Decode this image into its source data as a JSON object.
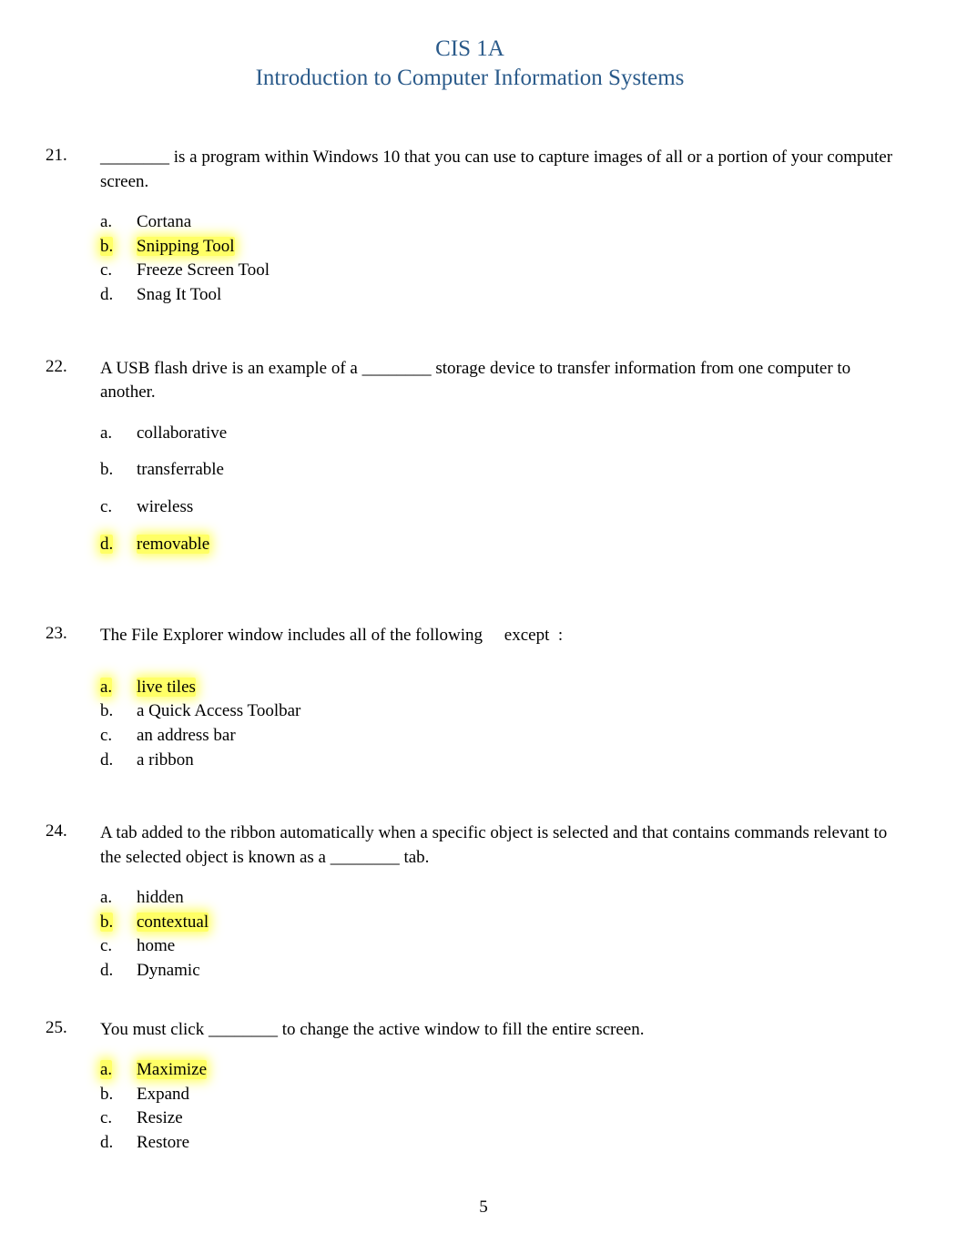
{
  "header": {
    "title": "CIS 1A",
    "subtitle": "Introduction to Computer Information Systems"
  },
  "questions": [
    {
      "num": "21.",
      "text": "________ is a program within Windows 10 that you can use to capture images of all or a portion of your computer screen.",
      "options": [
        {
          "label": "a.",
          "text": "Cortana",
          "highlighted": false
        },
        {
          "label": "b.",
          "text": "Snipping Tool",
          "highlighted": true
        },
        {
          "label": "c.",
          "text": "Freeze Screen Tool",
          "highlighted": false
        },
        {
          "label": "d.",
          "text": "Snag It Tool",
          "highlighted": false
        }
      ]
    },
    {
      "num": "22.",
      "text": "A USB flash drive is an example of a ________ storage device to transfer information from one computer to another.",
      "options": [
        {
          "label": "a.",
          "text": "collaborative",
          "highlighted": false
        },
        {
          "label": "b.",
          "text": "transferrable",
          "highlighted": false
        },
        {
          "label": "c.",
          "text": "wireless",
          "highlighted": false
        },
        {
          "label": "d.",
          "text": "removable",
          "highlighted": true
        }
      ]
    },
    {
      "num": "23.",
      "text": "The File Explorer window includes all of the following     except  :",
      "options": [
        {
          "label": "a.",
          "text": "live tiles",
          "highlighted": true
        },
        {
          "label": "b.",
          "text": "a Quick Access Toolbar",
          "highlighted": false
        },
        {
          "label": "c.",
          "text": "an address bar",
          "highlighted": false
        },
        {
          "label": "d.",
          "text": "a ribbon",
          "highlighted": false
        }
      ]
    },
    {
      "num": "24.",
      "text": "A tab added to the ribbon automatically when a specific object is selected and that contains commands relevant to the selected object is known as a ________ tab.",
      "options": [
        {
          "label": "a.",
          "text": "hidden",
          "highlighted": false
        },
        {
          "label": "b.",
          "text": "contextual",
          "highlighted": true
        },
        {
          "label": "c.",
          "text": "home",
          "highlighted": false
        },
        {
          "label": "d.",
          "text": "Dynamic",
          "highlighted": false
        }
      ]
    },
    {
      "num": "25.",
      "text": "You must click ________ to change the active window to fill the entire screen.",
      "options": [
        {
          "label": "a.",
          "text": "Maximize",
          "highlighted": true
        },
        {
          "label": "b.",
          "text": "Expand",
          "highlighted": false
        },
        {
          "label": "c.",
          "text": "Resize",
          "highlighted": false
        },
        {
          "label": "d.",
          "text": "Restore",
          "highlighted": false
        }
      ]
    }
  ],
  "page_number": "5"
}
